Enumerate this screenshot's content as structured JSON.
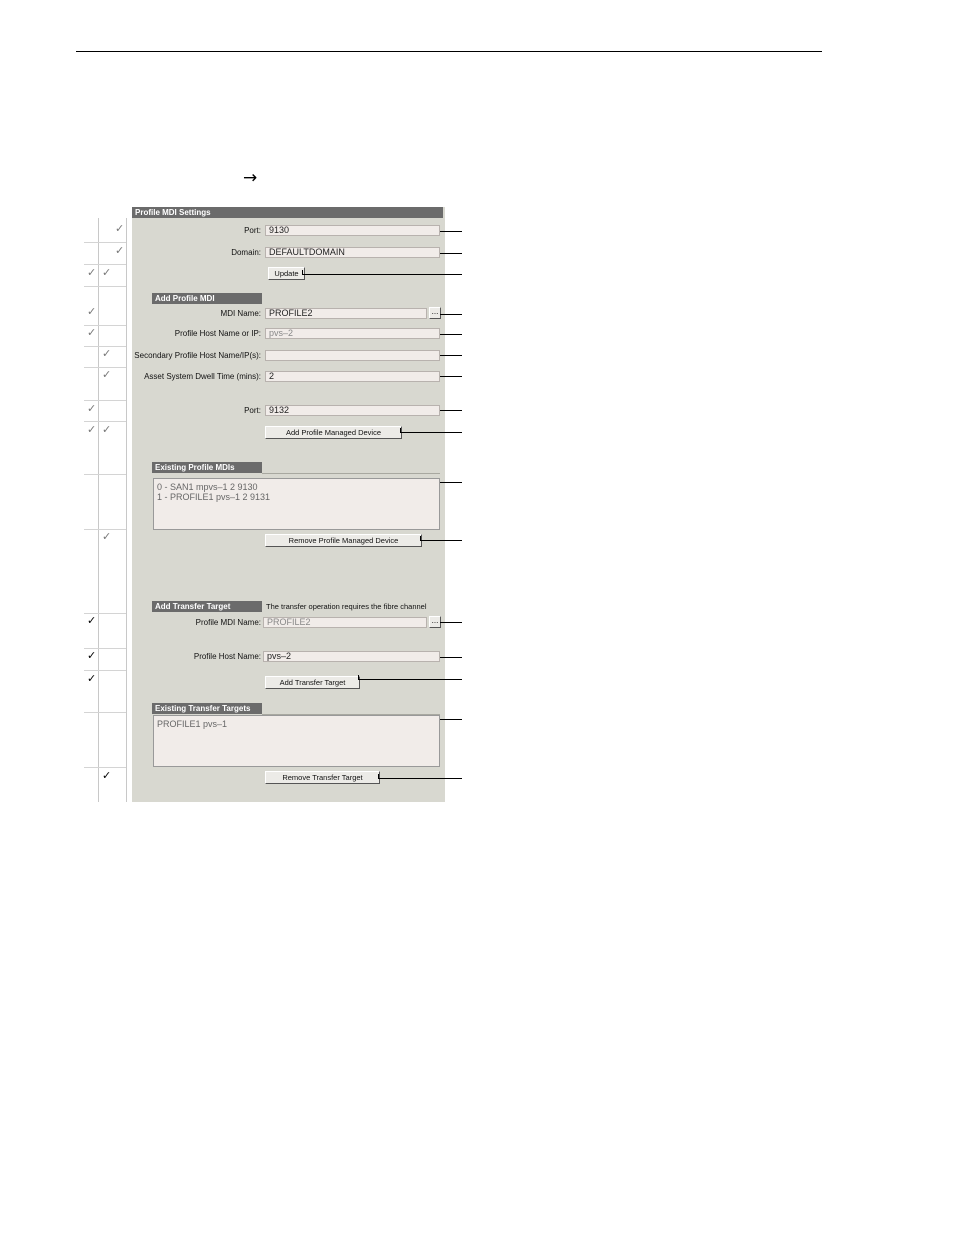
{
  "nav": {
    "arrow_glyph": "→"
  },
  "panel": {
    "title": "Profile MDI Settings",
    "port_label": "Port:",
    "port_value": "9130",
    "domain_label": "Domain:",
    "domain_value": "DEFAULTDOMAIN",
    "update_label": "Update"
  },
  "add_mdi": {
    "title": "Add Profile MDI",
    "mdi_name_label": "MDI Name:",
    "mdi_name_value": "PROFILE2",
    "browse_label": "...",
    "host_label": "Profile Host Name or IP:",
    "host_value": "pvs–2",
    "secondary_label": "Secondary Profile Host Name/IP(s):",
    "secondary_value": "",
    "dwell_label": "Asset System Dwell Time (mins):",
    "dwell_value": "2",
    "port_label": "Port:",
    "port_value": "9132",
    "add_button": "Add Profile Managed Device"
  },
  "existing_mdis": {
    "title": "Existing Profile MDIs",
    "items": [
      "0 - SAN1 mpvs–1 2 9130",
      "1 - PROFILE1 pvs–1 2 9131"
    ],
    "remove_button": "Remove Profile Managed Device"
  },
  "transfer": {
    "title": "Add Transfer Target",
    "note": "The transfer operation requires the fibre channel",
    "mdi_label": "Profile MDI Name:",
    "mdi_value": "PROFILE2",
    "browse_label": "...",
    "host_label": "Profile Host Name:",
    "host_value": "pvs–2",
    "add_button": "Add Transfer Target"
  },
  "existing_targets": {
    "title": "Existing Transfer Targets",
    "items": [
      "PROFILE1 pvs–1"
    ],
    "remove_button": "Remove Transfer Target"
  },
  "checks": {
    "mark": "✓"
  }
}
